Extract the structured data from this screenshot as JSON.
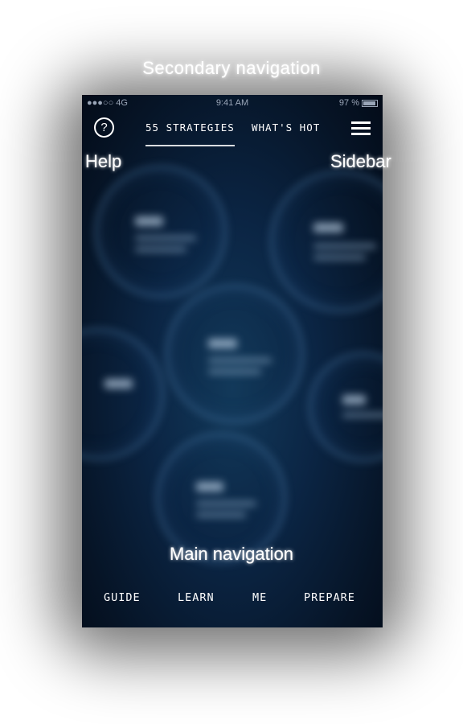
{
  "annotations": {
    "secondary_navigation": "Secondary navigation",
    "help": "Help",
    "sidebar": "Sidebar",
    "main_navigation": "Main navigation"
  },
  "status_bar": {
    "carrier": "●●●○○ 4G",
    "time": "9:41 AM",
    "battery": "97 %"
  },
  "header": {
    "help_icon": "question-circle-icon",
    "help_glyph": "?",
    "tabs": [
      {
        "label": "55 STRATEGIES",
        "active": true
      },
      {
        "label": "WHAT'S HOT",
        "active": false
      }
    ],
    "menu_icon": "hamburger-menu-icon"
  },
  "main_nav": {
    "items": [
      {
        "label": "GUIDE"
      },
      {
        "label": "LEARN"
      },
      {
        "label": "ME"
      },
      {
        "label": "PREPARE"
      }
    ]
  },
  "colors": {
    "background": "#061426",
    "accent_ring": "#5a8cb9",
    "text": "#ffffff"
  }
}
